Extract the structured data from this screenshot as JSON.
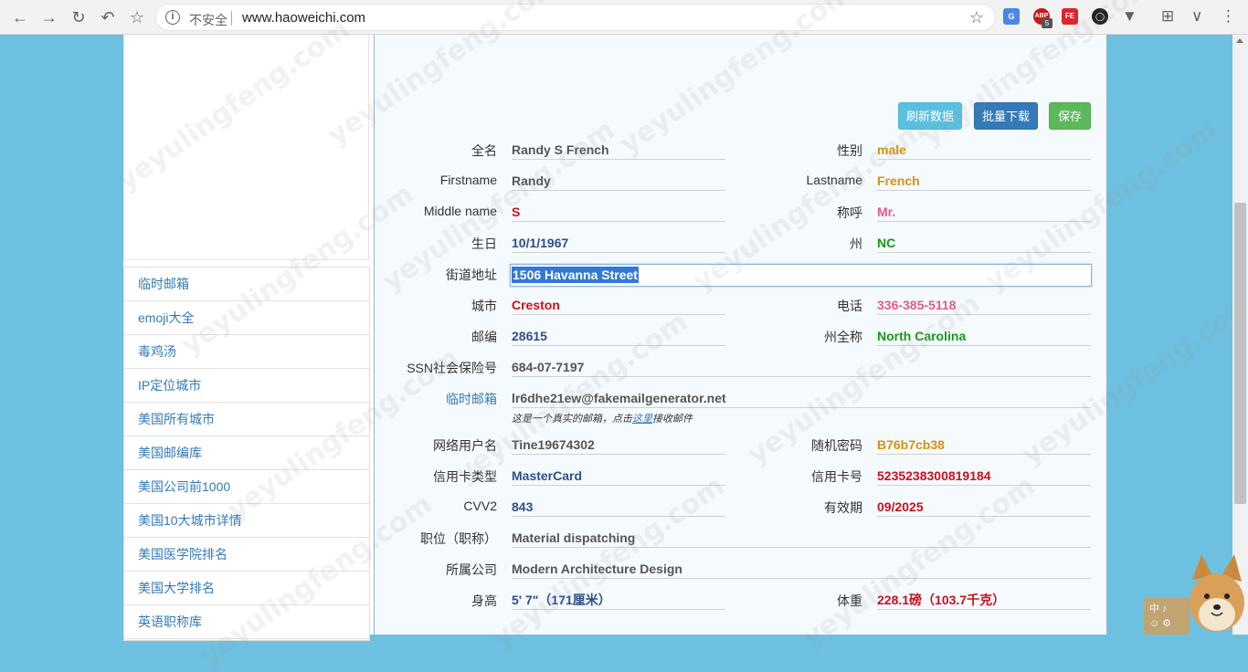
{
  "browser": {
    "insecure_label": "不安全",
    "url": "www.haoweichi.com",
    "ext_badge": "5",
    "ext_abp_label": "ABP",
    "ext_fe_label": "FE"
  },
  "sidebar": {
    "items": [
      {
        "label": "临时邮箱"
      },
      {
        "label": "emoji大全"
      },
      {
        "label": "毒鸡汤"
      },
      {
        "label": "IP定位城市"
      },
      {
        "label": "美国所有城市"
      },
      {
        "label": "美国邮编库"
      },
      {
        "label": "美国公司前1000"
      },
      {
        "label": "美国10大城市详情"
      },
      {
        "label": "美国医学院排名"
      },
      {
        "label": "美国大学排名"
      },
      {
        "label": "英语职称库"
      }
    ]
  },
  "buttons": {
    "refresh": "刷新数据",
    "download": "批量下载",
    "save": "保存"
  },
  "fields": {
    "fullname": {
      "label": "全名",
      "value": "Randy S French"
    },
    "gender": {
      "label": "性别",
      "value": "male"
    },
    "firstname": {
      "label": "Firstname",
      "value": "Randy"
    },
    "lastname": {
      "label": "Lastname",
      "value": "French"
    },
    "middlename": {
      "label": "Middle name",
      "value": "S"
    },
    "title": {
      "label": "称呼",
      "value": "Mr."
    },
    "birthday": {
      "label": "生日",
      "value": "10/1/1967"
    },
    "state": {
      "label": "州",
      "value": "NC"
    },
    "street": {
      "label": "街道地址",
      "value": "1506 Havanna Street"
    },
    "city": {
      "label": "城市",
      "value": "Creston"
    },
    "phone": {
      "label": "电话",
      "value": "336-385-5118"
    },
    "zip": {
      "label": "邮编",
      "value": "28615"
    },
    "state_full": {
      "label": "州全称",
      "value": "North Carolina"
    },
    "ssn": {
      "label": "SSN社会保险号",
      "value": "684-07-7197"
    },
    "email": {
      "label": "临时邮箱",
      "value": "lr6dhe21ew@fakemailgenerator.net"
    },
    "email_note_pre": "这是一个真实的邮箱，点击",
    "email_note_link": "这里",
    "email_note_post": "接收邮件",
    "username": {
      "label": "网络用户名",
      "value": "Tine19674302"
    },
    "password": {
      "label": "随机密码",
      "value": "B76b7cb38"
    },
    "card_type": {
      "label": "信用卡类型",
      "value": "MasterCard"
    },
    "card_number": {
      "label": "信用卡号",
      "value": "5235238300819184"
    },
    "cvv": {
      "label": "CVV2",
      "value": "843"
    },
    "expiry": {
      "label": "有效期",
      "value": "09/2025"
    },
    "occupation": {
      "label": "职位（职称）",
      "value": "Material dispatching"
    },
    "company": {
      "label": "所属公司",
      "value": "Modern Architecture Design"
    },
    "height": {
      "label": "身高",
      "value": "5' 7\"（171厘米）"
    },
    "weight": {
      "label": "体重",
      "value": "228.1磅（103.7千克）"
    }
  },
  "watermark": "yeyulingfeng.com",
  "widget": {
    "line1": "中 ♪",
    "line2": "☺ ⚙"
  },
  "colors": {
    "background": "#6ec0e0",
    "orange": "#d4920f",
    "red": "#c9111a",
    "pink": "#e8578e",
    "navy": "#2e4f8a",
    "green": "#169a16",
    "link": "#337ab7"
  }
}
